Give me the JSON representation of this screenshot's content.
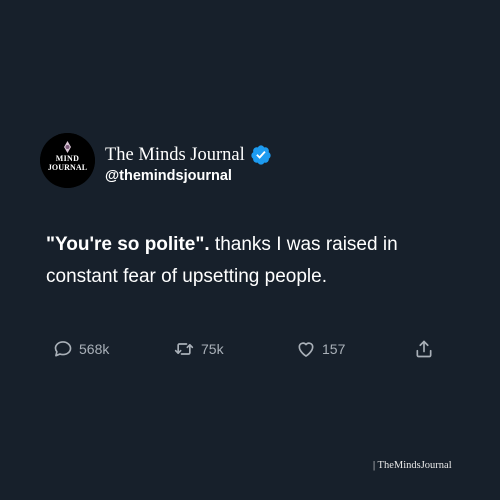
{
  "tweet": {
    "author": {
      "display_name": "The Minds Journal",
      "handle": "@themindsjournal",
      "avatar_logo_text": [
        "MIND",
        "JOURNAL"
      ],
      "verified": true
    },
    "text_bold": "\"You're so polite\".",
    "text_rest": " thanks I was raised in constant fear of upsetting people.",
    "actions": {
      "replies": "568k",
      "retweets": "75k",
      "likes": "157"
    }
  },
  "watermark": "| TheMindsJournal",
  "colors": {
    "background": "#17202b",
    "text": "#ffffff",
    "muted": "#a9b0b8",
    "verified_badge": "#1d9bf0"
  },
  "icons": {
    "verified": "verified-badge-icon",
    "reply": "comment-bubble-icon",
    "retweet": "retweet-icon",
    "like": "heart-outline-icon",
    "share": "share-upload-icon"
  }
}
